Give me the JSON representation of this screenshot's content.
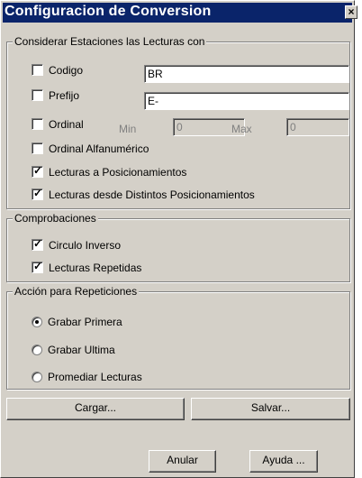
{
  "window": {
    "title": "Configuracion de Conversion",
    "close_glyph": "×"
  },
  "group_estaciones": {
    "legend": "Considerar Estaciones las Lecturas con",
    "codigo": {
      "label": "Codigo",
      "checked": false,
      "value": "BR"
    },
    "prefijo": {
      "label": "Prefijo",
      "checked": false,
      "value": "E-"
    },
    "ordinal": {
      "label": "Ordinal",
      "checked": false,
      "min_label": "Min",
      "min_value": "0",
      "max_label": "Max",
      "max_value": "0"
    },
    "ordinal_alfa": {
      "label": "Ordinal Alfanumérico",
      "checked": false
    },
    "lecturas_pos": {
      "label": "Lecturas a Posicionamientos",
      "checked": true
    },
    "lecturas_dist": {
      "label": "Lecturas desde Distintos Posicionamientos",
      "checked": true
    }
  },
  "group_comprobaciones": {
    "legend": "Comprobaciones",
    "circulo": {
      "label": "Circulo Inverso",
      "checked": true
    },
    "repetidas": {
      "label": "Lecturas Repetidas",
      "checked": true
    }
  },
  "group_accion": {
    "legend": "Acción para Repeticiones",
    "options": [
      "Grabar Primera",
      "Grabar Ultima",
      "Promediar Lecturas"
    ],
    "selected": "Grabar Primera"
  },
  "buttons": {
    "cargar": "Cargar...",
    "salvar": "Salvar...",
    "anular": "Anular",
    "ayuda": "Ayuda ..."
  },
  "check_glyph": "✓"
}
